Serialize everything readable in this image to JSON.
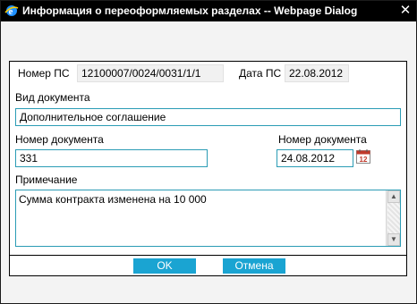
{
  "window": {
    "title": "Информация о переоформляемых разделах -- Webpage Dialog",
    "close_glyph": "✕"
  },
  "header": {
    "ps_number_label": "Номер ПС",
    "ps_number_value": "12100007/0024/0031/1/1",
    "ps_date_label": "Дата ПС",
    "ps_date_value": "22.08.2012"
  },
  "form": {
    "doc_type_label": "Вид документа",
    "doc_type_value": "Дополнительное соглашение",
    "doc_number_label": "Номер документа",
    "doc_number_value": "331",
    "doc_date_label": "Номер документа",
    "doc_date_value": "24.08.2012",
    "note_label": "Примечание",
    "note_value": "Сумма контракта изменена на 10 000",
    "calendar_day": "12"
  },
  "buttons": {
    "ok_label": "OK",
    "cancel_label": "Отмена"
  },
  "colors": {
    "input_border": "#2b9cb5",
    "button_bg": "#1aa4d2"
  },
  "icons": [
    "ie-icon",
    "close-icon",
    "calendar-icon",
    "scroll-up-icon",
    "scroll-down-icon"
  ]
}
